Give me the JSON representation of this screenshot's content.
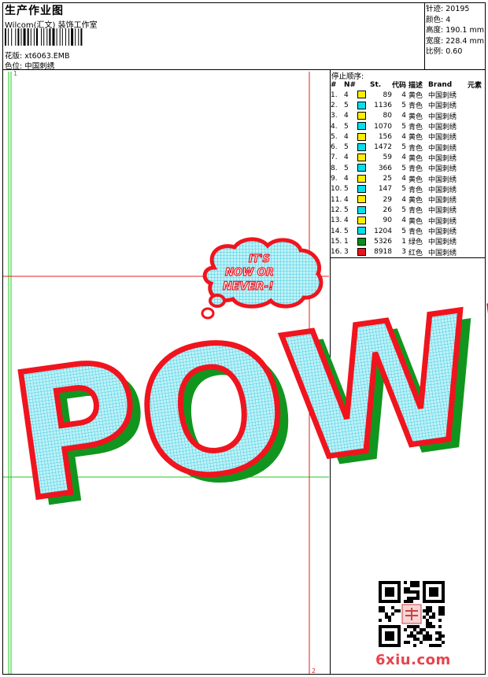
{
  "header": {
    "title": "生产作业图",
    "company": "Wilcom(汇文) 装饰工作室",
    "design_label": "花版:",
    "design_value": "xt6063.EMB",
    "color_label": "色位:",
    "color_value": "中国刺绣"
  },
  "stats": {
    "stitches_label": "针迹:",
    "stitches": "20195",
    "colors_label": "颜色:",
    "colors": "4",
    "height_label": "高度:",
    "height": "190.1 mm",
    "width_label": "宽度:",
    "width": "228.4 mm",
    "scale_label": "比例:",
    "scale": "0.60"
  },
  "stop_sequence": {
    "title": "停止顺序:",
    "headers": [
      "#",
      "N#",
      "St.",
      "代码",
      "描述",
      "Brand",
      "元素"
    ],
    "rows": [
      {
        "idx": "1.",
        "n": "4",
        "swatch": "#ffee00",
        "st": "89",
        "code": "4",
        "desc": "黄色",
        "brand": "中国刺绣"
      },
      {
        "idx": "2.",
        "n": "5",
        "swatch": "#00e0ee",
        "st": "1136",
        "code": "5",
        "desc": "青色",
        "brand": "中国刺绣"
      },
      {
        "idx": "3.",
        "n": "4",
        "swatch": "#ffee00",
        "st": "80",
        "code": "4",
        "desc": "黄色",
        "brand": "中国刺绣"
      },
      {
        "idx": "4.",
        "n": "5",
        "swatch": "#00e0ee",
        "st": "1070",
        "code": "5",
        "desc": "青色",
        "brand": "中国刺绣"
      },
      {
        "idx": "5.",
        "n": "4",
        "swatch": "#ffee00",
        "st": "156",
        "code": "4",
        "desc": "黄色",
        "brand": "中国刺绣"
      },
      {
        "idx": "6.",
        "n": "5",
        "swatch": "#00e0ee",
        "st": "1472",
        "code": "5",
        "desc": "青色",
        "brand": "中国刺绣"
      },
      {
        "idx": "7.",
        "n": "4",
        "swatch": "#ffee00",
        "st": "59",
        "code": "4",
        "desc": "黄色",
        "brand": "中国刺绣"
      },
      {
        "idx": "8.",
        "n": "5",
        "swatch": "#00e0ee",
        "st": "366",
        "code": "5",
        "desc": "青色",
        "brand": "中国刺绣"
      },
      {
        "idx": "9.",
        "n": "4",
        "swatch": "#ffee00",
        "st": "25",
        "code": "4",
        "desc": "黄色",
        "brand": "中国刺绣"
      },
      {
        "idx": "10.",
        "n": "5",
        "swatch": "#00e0ee",
        "st": "147",
        "code": "5",
        "desc": "青色",
        "brand": "中国刺绣"
      },
      {
        "idx": "11.",
        "n": "4",
        "swatch": "#ffee00",
        "st": "29",
        "code": "4",
        "desc": "黄色",
        "brand": "中国刺绣"
      },
      {
        "idx": "12.",
        "n": "5",
        "swatch": "#00e0ee",
        "st": "26",
        "code": "5",
        "desc": "青色",
        "brand": "中国刺绣"
      },
      {
        "idx": "13.",
        "n": "4",
        "swatch": "#ffee00",
        "st": "90",
        "code": "4",
        "desc": "黄色",
        "brand": "中国刺绣"
      },
      {
        "idx": "14.",
        "n": "5",
        "swatch": "#00e0ee",
        "st": "1204",
        "code": "5",
        "desc": "青色",
        "brand": "中国刺绣"
      },
      {
        "idx": "15.",
        "n": "1",
        "swatch": "#0a8c1e",
        "st": "5326",
        "code": "1",
        "desc": "绿色",
        "brand": "中国刺绣"
      },
      {
        "idx": "16.",
        "n": "3",
        "swatch": "#e8141e",
        "st": "8918",
        "code": "3",
        "desc": "红色",
        "brand": "中国刺绣"
      }
    ]
  },
  "design": {
    "word_main": "POW!",
    "bubble_line1": "IT'S",
    "bubble_line2": "NOW OR",
    "bubble_line3": "NEVER-!",
    "colors": {
      "red": "#f0141e",
      "green": "#10961e",
      "cyan": "#40dcf0",
      "guide_green": "#22c822",
      "guide_red": "#e02020"
    },
    "corner_start": "1",
    "corner_end": "2"
  },
  "watermark": "6xiu.com"
}
